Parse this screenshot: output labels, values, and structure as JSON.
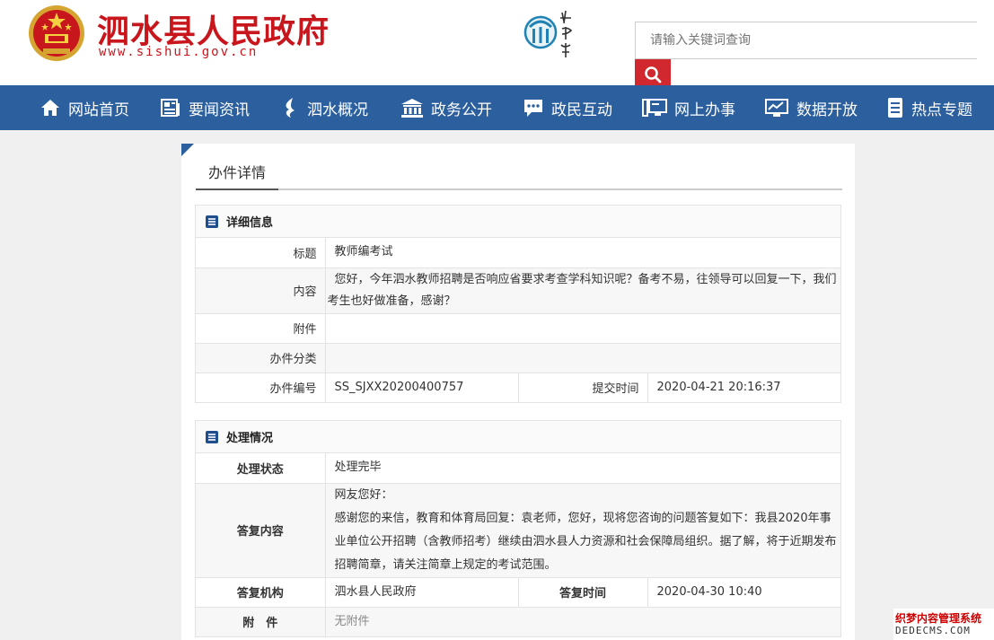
{
  "header": {
    "site_title": "泗水县人民政府",
    "site_url": "www.sishui.gov.cn",
    "search_placeholder": "请输入关键词查询"
  },
  "nav": [
    {
      "label": "网站首页",
      "icon": "home-icon"
    },
    {
      "label": "要闻资讯",
      "icon": "news-icon"
    },
    {
      "label": "泗水概况",
      "icon": "water-icon"
    },
    {
      "label": "政务公开",
      "icon": "building-icon"
    },
    {
      "label": "政民互动",
      "icon": "chat-icon"
    },
    {
      "label": "网上办事",
      "icon": "desktop-icon"
    },
    {
      "label": "数据开放",
      "icon": "chart-icon"
    },
    {
      "label": "热点专题",
      "icon": "document-icon"
    }
  ],
  "page_title": "办件详情",
  "detail": {
    "heading": "详细信息",
    "title_label": "标题",
    "title_value": "教师编考试",
    "content_label": "内容",
    "content_value": "您好，今年泗水教师招聘是否响应省要求考查学科知识呢？备考不易，往领导可以回复一下，我们考生也好做准备，感谢？",
    "attachment_label": "附件",
    "attachment_value": "",
    "category_label": "办件分类",
    "category_value": "",
    "number_label": "办件编号",
    "number_value": "SS_SJXX20200400757",
    "submit_time_label": "提交时间",
    "submit_time_value": "2020-04-21 20:16:37"
  },
  "handling": {
    "heading": "处理情况",
    "status_label": "处理状态",
    "status_value": "处理完毕",
    "reply_label": "答复内容",
    "reply_greeting": "网友您好：",
    "reply_body": "感谢您的来信，教育和体育局回复：袁老师，您好，现将您咨询的问题答复如下：我县2020年事业单位公开招聘（含教师招考）继续由泗水县人力资源和社会保障局组织。据了解，将于近期发布招聘简章，请关注简章上规定的考试范围。",
    "org_label": "答复机构",
    "org_value": "泗水县人民政府",
    "reply_time_label": "答复时间",
    "reply_time_value": "2020-04-30 10:40",
    "attachment_label": "附　件",
    "attachment_value": "无附件"
  },
  "watermark": {
    "line1": "织梦内容管理系统",
    "line2": "DEDECMS.COM"
  },
  "colors": {
    "brand_red": "#c8161d",
    "nav_blue": "#2c5f9d",
    "search_red": "#d0282e"
  }
}
